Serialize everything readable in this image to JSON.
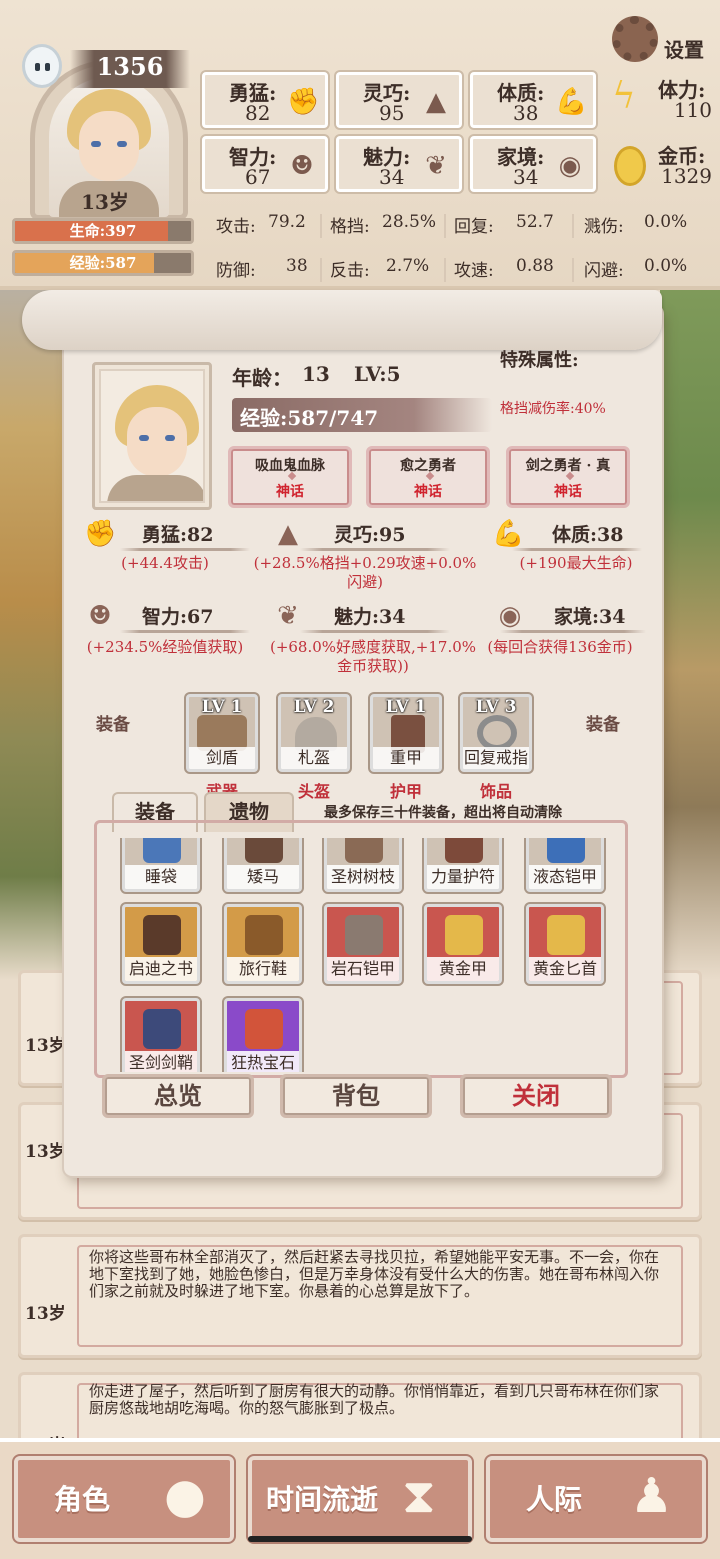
{
  "hud": {
    "score": "1356",
    "age": "13岁",
    "hp_label": "生命:397",
    "hp_fraction": 0.87,
    "xp_label": "经验:587",
    "xp_fraction": 0.79,
    "settings_label": "设置",
    "attributes": [
      {
        "label": "勇猛:",
        "value": "82",
        "icon": "fist-icon"
      },
      {
        "label": "灵巧:",
        "value": "95",
        "icon": "cloak-icon"
      },
      {
        "label": "体质:",
        "value": "38",
        "icon": "muscle-icon"
      },
      {
        "label": "智力:",
        "value": "67",
        "icon": "brain-icon"
      },
      {
        "label": "魅力:",
        "value": "34",
        "icon": "flower-icon"
      },
      {
        "label": "家境:",
        "value": "34",
        "icon": "coin-hand-icon"
      }
    ],
    "stamina": {
      "label": "体力:",
      "value": "110"
    },
    "gold": {
      "label": "金币:",
      "value": "1329"
    },
    "combat": [
      [
        "攻击:",
        "79.2",
        "格挡:",
        "28.5%",
        "回复:",
        "52.7",
        "溅伤:",
        "0.0%"
      ],
      [
        "防御:",
        "38",
        "反击:",
        "2.7%",
        "攻速:",
        "0.88",
        "闪避:",
        "0.0%"
      ]
    ]
  },
  "sheet": {
    "age_label": "年龄：",
    "age_value": "13",
    "level": "LV:5",
    "xp": "经验:587/747",
    "xp_fraction": 0.786,
    "special_title": "特殊属性:",
    "special_value": "格挡减伤率:40%",
    "traits": [
      {
        "name": "吸血鬼血脉",
        "rank": "神话"
      },
      {
        "name": "愈之勇者",
        "rank": "神话"
      },
      {
        "name": "剑之勇者 · 真",
        "rank": "神话"
      }
    ],
    "attr_details": [
      {
        "name": "勇猛:82",
        "bonus": "(+44.4攻击)"
      },
      {
        "name": "灵巧:95",
        "bonus": "(+28.5%格挡+0.29攻速+0.0%闪避)"
      },
      {
        "name": "体质:38",
        "bonus": "(+190最大生命)"
      },
      {
        "name": "智力:67",
        "bonus": "(+234.5%经验值获取)"
      },
      {
        "name": "魅力:34",
        "bonus": "(+68.0%好感度获取,+17.0%金币获取))"
      },
      {
        "name": "家境:34",
        "bonus": "(每回合获得136金币)"
      }
    ],
    "equip_label": "装备",
    "equipment": [
      {
        "level": "LV 1",
        "name": "剑盾",
        "type": "武器"
      },
      {
        "level": "LV 2",
        "name": "札盔",
        "type": "头盔"
      },
      {
        "level": "LV 1",
        "name": "重甲",
        "type": "护甲"
      },
      {
        "level": "LV 3",
        "name": "回复戒指",
        "type": "饰品"
      }
    ],
    "tabs": [
      "装备",
      "遗物"
    ],
    "tab_note": "最多保存三十件装备，超出将自动清除",
    "inventory": [
      "睡袋",
      "矮马",
      "圣树树枝",
      "力量护符",
      "液态铠甲",
      "启迪之书",
      "旅行鞋",
      "岩石铠甲",
      "黄金甲",
      "黄金匕首",
      "圣剑剑鞘",
      "狂热宝石"
    ],
    "buttons": {
      "overview": "总览",
      "backpack": "背包",
      "close": "关闭"
    }
  },
  "log": [
    {
      "age": "13岁",
      "text": ""
    },
    {
      "age": "13岁",
      "text": ""
    },
    {
      "age": "13岁",
      "text": "你将这些哥布林全部消灭了，然后赶紧去寻找贝拉，希望她能平安无事。不一会，你在地下室找到了她，她脸色惨白，但是万幸身体没有受什么大的伤害。她在哥布林闯入你们家之前就及时躲进了地下室。你悬着的心总算是放下了。"
    },
    {
      "age": "13岁",
      "text": "你走进了屋子，然后听到了厨房有很大的动静。你悄悄靠近，看到几只哥布林在你们家厨房悠哉地胡吃海喝。你的怒气膨胀到了极点。"
    }
  ],
  "nav": {
    "character": "角色",
    "time": "时间流逝",
    "social": "人际"
  },
  "colors": {
    "hp": "#d9714c",
    "xp": "#e4a45a",
    "accent_red": "#c0303a"
  }
}
